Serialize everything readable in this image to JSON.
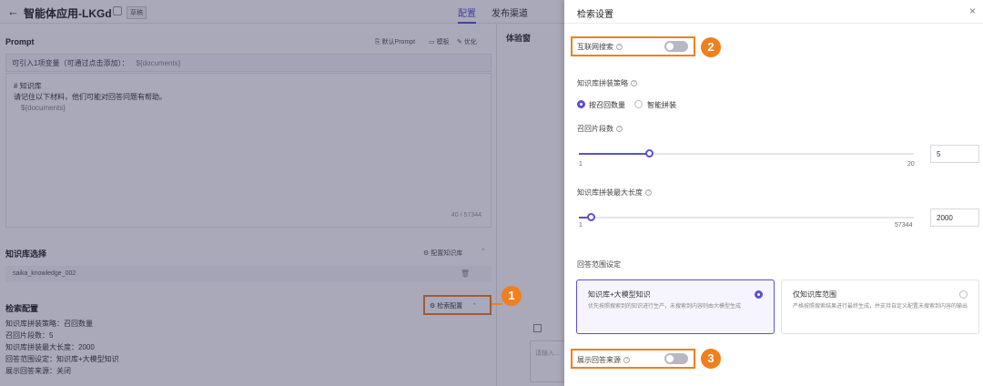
{
  "header": {
    "title": "智能体应用-LKGd",
    "badge": "草稿",
    "tabs": [
      "配置",
      "发布渠道"
    ]
  },
  "prompt": {
    "section_title": "Prompt",
    "tools": [
      "默认Prompt",
      "模板",
      "优化"
    ],
    "var_hint": "可引入1项变量（可通过点击添加）：",
    "var_tag": "${documents}",
    "lines": [
      "# 知识库",
      "请记住以下材料，他们可能对回答问题有帮助。",
      "${documents}"
    ],
    "counter": "40 / 57344"
  },
  "knowledge": {
    "section_title": "知识库选择",
    "config_link": "配置知识库",
    "item": "saika_knowledge_002"
  },
  "retrieval": {
    "section_title": "检索配置",
    "config_button": "检索配置",
    "lines": [
      "知识库拼装策略：召回数量",
      "召回片段数：5",
      "知识库拼装最大长度：2000",
      "回答范围设定：知识库+大模型知识",
      "展示回答来源：关闭"
    ]
  },
  "experience": {
    "title": "体验窗",
    "input_placeholder": "请输入..."
  },
  "drawer": {
    "title": "检索设置",
    "close": "×",
    "web_search_label": "互联网搜索",
    "web_search_on": false,
    "strategy_label": "知识库拼装策略",
    "strategy_options": [
      "按召回数量",
      "智能拼装"
    ],
    "strategy_selected": 0,
    "recall_label": "召回片段数",
    "recall_min": "1",
    "recall_max": "20",
    "recall_value": "5",
    "maxlen_label": "知识库拼装最大长度",
    "maxlen_min": "1",
    "maxlen_max": "57344",
    "maxlen_value": "2000",
    "scope_label": "回答范围设定",
    "scope_cards": [
      {
        "title": "知识库+大模型知识",
        "desc": "优先按照搜索到的知识进行生产，未搜索到内容则由大模型生成"
      },
      {
        "title": "仅知识库范围",
        "desc": "严格按照搜索结果进行最终生成，并支持自定义配置未搜索到内容的输出"
      }
    ],
    "scope_selected": 0,
    "show_source_label": "展示回答来源",
    "show_source_on": false
  },
  "annotations": [
    "1",
    "2",
    "3"
  ],
  "colors": {
    "accent": "#5b4fd6",
    "highlight": "#f07f1d"
  }
}
